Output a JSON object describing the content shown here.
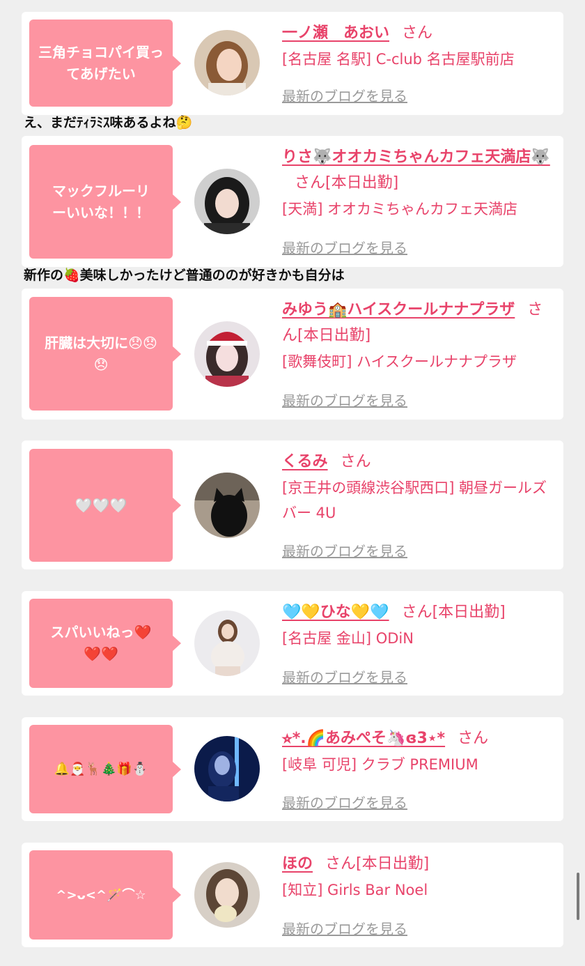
{
  "entries": [
    {
      "message": "三角チョコパイ買ってあげたい",
      "name": "一ノ瀬　あおい",
      "san": "さん",
      "status": "",
      "shop": "[名古屋 名駅] C-club 名古屋駅前店",
      "blog_link": "最新のブログを見る",
      "avatar_icon": "woman-photo-avatar"
    },
    {
      "message": "マックフルーリーいいな！！！",
      "name": "りさ🐺オオカミちゃんカフェ天満店🐺",
      "san": "さん",
      "status": "[本日出勤]",
      "shop": "[天満] オオカミちゃんカフェ天満店",
      "blog_link": "最新のブログを見る",
      "avatar_icon": "woman-photo-avatar"
    },
    {
      "message": "肝臓は大切に😞😞😞",
      "name": "みゆう🏫ハイスクールナナプラザ",
      "san": "さん",
      "status": "[本日出勤]",
      "shop": "[歌舞伎町] ハイスクールナナプラザ",
      "blog_link": "最新のブログを見る",
      "avatar_icon": "woman-santa-photo-avatar"
    },
    {
      "message": "🤍🤍🤍",
      "name": "くるみ",
      "san": "さん",
      "status": "",
      "shop": "[京王井の頭線渋谷駅西口] 朝昼ガールズバー 4U",
      "blog_link": "最新のブログを見る",
      "avatar_icon": "black-cat-photo-avatar"
    },
    {
      "message": "スパいいねっ❤️❤️❤️",
      "name": "🩵💛ひな💛🩵",
      "san": "さん",
      "status": "[本日出勤]",
      "shop": "[名古屋 金山] ODiN",
      "blog_link": "最新のブログを見る",
      "avatar_icon": "woman-photo-avatar"
    },
    {
      "message": "🔔🎅🦌🎄🎁⛄",
      "name": "⭐︎*.🌈あみぺそ🦄ɞ3⋆*",
      "san": "さん",
      "status": "",
      "shop": "[岐阜 可児] クラブ PREMIUM",
      "blog_link": "最新のブログを見る",
      "avatar_icon": "woman-neon-photo-avatar"
    },
    {
      "message": "^>ᴗ<^🪄⌒☆",
      "name": "ほの",
      "san": "さん",
      "status": "[本日出勤]",
      "shop": "[知立] Girls Bar Noel",
      "blog_link": "最新のブログを見る",
      "avatar_icon": "woman-photo-avatar"
    }
  ],
  "comments": [
    "え、まだﾃｨﾗﾐｽ味あるよね🤔",
    "新作の🍓美味しかったけど普通ののが好きかも自分は"
  ],
  "colors": {
    "background": "#efefef",
    "bubble": "#fd94a1",
    "accent": "#e8436a",
    "link_gray": "#9a9a9a"
  }
}
